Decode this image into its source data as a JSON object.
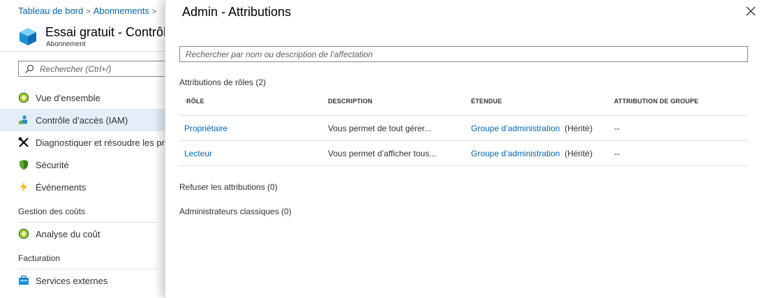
{
  "breadcrumb": {
    "items": [
      "Tableau de bord",
      "Abonnements"
    ],
    "separator": ">"
  },
  "resource": {
    "title": "Essai gratuit - Contrôle d’accès (IAM)",
    "subtitle": "Abonnement"
  },
  "left_search": {
    "placeholder": "Rechercher (Ctrl+/)"
  },
  "nav": {
    "items": [
      {
        "label": "Vue d’ensemble",
        "icon": "overview-icon"
      },
      {
        "label": "Contrôle d’accès (IAM)",
        "icon": "iam-icon",
        "selected": true
      },
      {
        "label": "Diagnostiquer et résoudre les problèmes",
        "icon": "tools-icon"
      },
      {
        "label": "Sécurité",
        "icon": "shield-icon"
      },
      {
        "label": "Événements",
        "icon": "lightning-icon"
      }
    ],
    "cost_section": "Gestion des coûts",
    "cost_items": [
      {
        "label": "Analyse du coût",
        "icon": "cost-analysis-icon"
      }
    ],
    "billing_section": "Facturation",
    "billing_items": [
      {
        "label": "Services externes",
        "icon": "external-services-icon"
      }
    ]
  },
  "panel": {
    "title": "Admin - Attributions",
    "search_placeholder": "Rechercher par nom ou description de l’affectation",
    "roles_label": "Attributions de rôles (2)",
    "columns": [
      "RÔLE",
      "DESCRIPTION",
      "ÉTENDUE",
      "ATTRIBUTION DE GROUPE"
    ],
    "rows": [
      {
        "role": "Propriétaire",
        "description": "Vous permet de tout gérer...",
        "scope": "Groupe d’administration",
        "inherited": "(Hérité)",
        "group": "--"
      },
      {
        "role": "Lecteur",
        "description": "Vous permet d’afficher tous...",
        "scope": "Groupe d’administration",
        "inherited": "(Hérité)",
        "group": "--"
      }
    ],
    "deny_label": "Refuser les attributions (0)",
    "classic_label": "Administrateurs classiques (0)"
  },
  "colors": {
    "link": "#0067b8",
    "selected_bg": "#e3eef9",
    "divider": "#e1e1e1"
  }
}
